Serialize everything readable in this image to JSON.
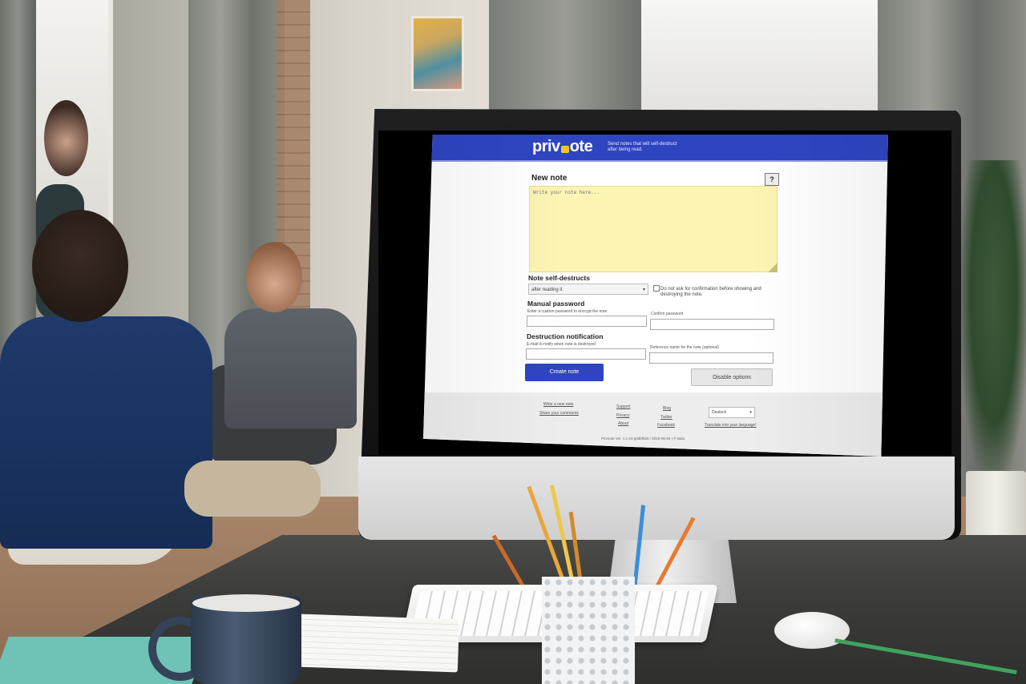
{
  "header": {
    "logo_text_before": "priv",
    "logo_text_after": "ote",
    "tagline": "Send notes that will self-destruct after being read."
  },
  "form": {
    "new_note_title": "New note",
    "help_label": "?",
    "note_placeholder": "Write your note here...",
    "self_destruct": {
      "heading": "Note self-destructs",
      "selected": "after reading it",
      "confirm_checkbox_text": "Do not ask for confirmation before showing and destroying the note."
    },
    "manual_password": {
      "heading": "Manual password",
      "password_label": "Enter a custom password to encrypt the note",
      "confirm_label": "Confirm password"
    },
    "destruction_notification": {
      "heading": "Destruction notification",
      "email_label": "E-mail to notify when note is destroyed",
      "reference_label": "Reference name for the note (optional)"
    },
    "create_button": "Create note",
    "disable_button": "Disable options"
  },
  "footer": {
    "links_col1": [
      "Write a new note",
      "Share your comments"
    ],
    "links_col2": [
      "Support",
      "Privacy",
      "About"
    ],
    "links_col3": [
      "Blog",
      "Twitter",
      "Facebook"
    ],
    "language_selected": "Deutsch",
    "translate_link": "Translate into your language!",
    "version_text": "Privnote Ver. 1.1.44-g0dbf826 / 2018-06-25 | ® Italia"
  },
  "colors": {
    "brand_blue": "#2f44c1",
    "note_yellow": "#fbf4b3"
  },
  "icons": {
    "lock": "lock-icon",
    "dropdown": "chevron-down-icon"
  }
}
